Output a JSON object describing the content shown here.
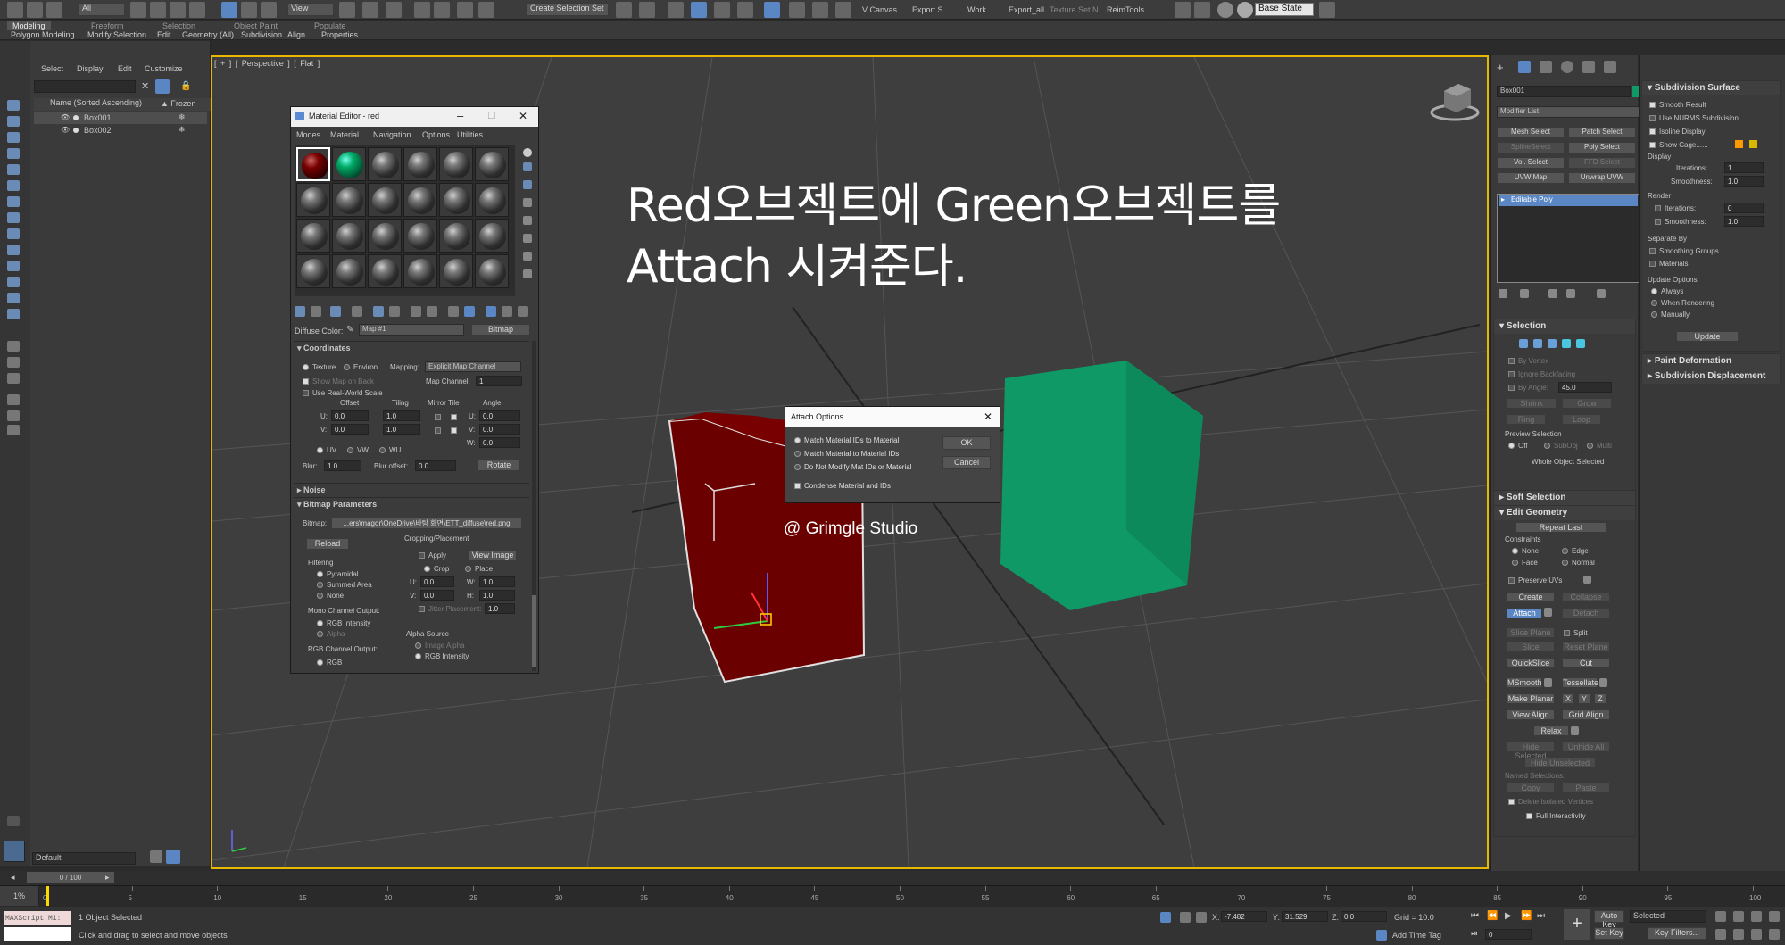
{
  "toolbar": {
    "filter": "All",
    "view": "View",
    "selection_set": "Create Selection Set",
    "base_state": "Base State",
    "items": [
      "V Canvas",
      "Export S",
      "Work",
      "Export_all",
      "Texture Set N",
      "ReimTools"
    ]
  },
  "ribbon_tabs": [
    "Modeling",
    "Freeform",
    "Selection",
    "Object Paint",
    "Populate"
  ],
  "ribbon_sub": [
    "Polygon Modeling",
    "Modify Selection",
    "Edit",
    "Geometry (All)",
    "Subdivision",
    "Align",
    "Properties"
  ],
  "scene_explorer": {
    "menu": [
      "Select",
      "Display",
      "Edit",
      "Customize"
    ],
    "column": "Name (Sorted Ascending)",
    "frozen": "▲ Frozen",
    "items": [
      "Box001",
      "Box002"
    ]
  },
  "viewport": {
    "label": "[ + ] [ Perspective ] [ Flat ]",
    "title_line1": "Red오브젝트에 Green오브젝트를",
    "title_line2": "Attach 시켜준다.",
    "watermark": "@ Grimgle Studio"
  },
  "material_editor": {
    "title": "Material Editor - red",
    "menu": [
      "Modes",
      "Material",
      "Navigation",
      "Options",
      "Utilities"
    ],
    "diffuse_label": "Diffuse Color:",
    "map_name": "Map #1",
    "map_type": "Bitmap",
    "coordinates": {
      "title": "Coordinates",
      "texture": "Texture",
      "environ": "Environ",
      "mapping_label": "Mapping:",
      "mapping_value": "Explicit Map Channel",
      "show_map": "Show Map on Back",
      "map_channel_label": "Map Channel:",
      "map_channel": "1",
      "real_world": "Use Real-World Scale",
      "offset": "Offset",
      "tiling": "Tiling",
      "mirror_tile": "Mirror Tile",
      "angle": "Angle",
      "u": "U:",
      "v": "V:",
      "w": "W:",
      "u_offset": "0.0",
      "v_offset": "0.0",
      "u_tiling": "1.0",
      "v_tiling": "1.0",
      "u_angle": "0.0",
      "v_angle": "0.0",
      "w_angle": "0.0",
      "uv": "UV",
      "vw": "VW",
      "wu": "WU",
      "blur_label": "Blur:",
      "blur": "1.0",
      "blur_offset_label": "Blur offset:",
      "blur_offset": "0.0",
      "rotate": "Rotate"
    },
    "noise": "Noise",
    "bitmap_params": {
      "title": "Bitmap Parameters",
      "bitmap_label": "Bitmap:",
      "path": "...ers\\magor\\OneDrive\\바탕 화면\\ETT_diffuse\\red.png",
      "reload": "Reload",
      "cropping": "Cropping/Placement",
      "apply": "Apply",
      "view_image": "View Image",
      "crop": "Crop",
      "place": "Place",
      "filtering": "Filtering",
      "pyramidal": "Pyramidal",
      "summed": "Summed Area",
      "none": "None",
      "u": "U:",
      "v": "V:",
      "w": "W:",
      "h": "H:",
      "u_val": "0.0",
      "v_val": "0.0",
      "w_val": "1.0",
      "h_val": "1.0",
      "jitter": "Jitter Placement:",
      "jitter_val": "1.0",
      "mono": "Mono Channel Output:",
      "rgb_intensity": "RGB Intensity",
      "alpha": "Alpha",
      "rgb_out": "RGB Channel Output:",
      "rgb": "RGB",
      "alpha_source": "Alpha Source",
      "image_alpha": "Image Alpha",
      "rgb_intensity2": "RGB Intensity"
    }
  },
  "attach_dialog": {
    "title": "Attach Options",
    "options": [
      "Match Material IDs to Material",
      "Match Material to Material IDs",
      "Do Not Modify Mat IDs or Material"
    ],
    "condense": "Condense Material and IDs",
    "ok": "OK",
    "cancel": "Cancel"
  },
  "command_panel": {
    "object_name": "Box001",
    "modifier_list": "Modifier List",
    "buttons": [
      "Mesh Select",
      "Patch Select",
      "SplineSelect",
      "Poly Select",
      "Vol. Select",
      "FFD Select",
      "UVW Map",
      "Unwrap UVW"
    ],
    "stack_item": "Editable Poly",
    "selection": {
      "title": "Selection",
      "by_vertex": "By Vertex",
      "ignore_backfacing": "Ignore Backfacing",
      "by_angle": "By Angle:",
      "angle": "45.0",
      "shrink": "Shrink",
      "grow": "Grow",
      "ring": "Ring",
      "loop": "Loop",
      "preview": "Preview Selection",
      "off": "Off",
      "subobj": "SubObj",
      "multi": "Multi",
      "whole": "Whole Object Selected"
    },
    "soft_selection": "Soft Selection",
    "edit_geometry": {
      "title": "Edit Geometry",
      "repeat_last": "Repeat Last",
      "constraints": "Constraints",
      "none": "None",
      "edge": "Edge",
      "face": "Face",
      "normal": "Normal",
      "preserve_uvs": "Preserve UVs",
      "create": "Create",
      "collapse": "Collapse",
      "attach": "Attach",
      "detach": "Detach",
      "slice_plane": "Slice Plane",
      "split": "Split",
      "slice": "Slice",
      "reset_plane": "Reset Plane",
      "quickslice": "QuickSlice",
      "cut": "Cut",
      "msmooth": "MSmooth",
      "tessellate": "Tessellate",
      "make_planar": "Make Planar",
      "x": "X",
      "y": "Y",
      "z": "Z",
      "view_align": "View Align",
      "grid_align": "Grid Align",
      "relax": "Relax",
      "hide_selected": "Hide Selected",
      "unhide_all": "Unhide All",
      "hide_unselected": "Hide Unselected",
      "named_selections": "Named Selections:",
      "copy": "Copy",
      "paste": "Paste",
      "delete_isolated": "Delete Isolated Vertices",
      "full_interactivity": "Full Interactivity"
    }
  },
  "subdivision_panel": {
    "title": "Subdivision Surface",
    "smooth_result": "Smooth Result",
    "use_nurms": "Use NURMS Subdivision",
    "isoline": "Isoline Display",
    "show_cage": "Show Cage......",
    "display": "Display",
    "iterations_label": "Iterations:",
    "iterations": "1",
    "smoothness_label": "Smoothness:",
    "smoothness": "1.0",
    "render": "Render",
    "r_iterations": "0",
    "r_smoothness": "1.0",
    "separate_by": "Separate By",
    "smoothing_groups": "Smoothing Groups",
    "materials": "Materials",
    "update_options": "Update Options",
    "always": "Always",
    "when_rendering": "When Rendering",
    "manually": "Manually",
    "update": "Update",
    "paint_deformation": "Paint Deformation",
    "subdivision_displacement": "Subdivision Displacement"
  },
  "timeline": {
    "frame": "0 / 100",
    "layer": "Default",
    "ticks": [
      "0",
      "5",
      "10",
      "15",
      "20",
      "25",
      "30",
      "35",
      "40",
      "45",
      "50",
      "55",
      "60",
      "65",
      "70",
      "75",
      "80",
      "85",
      "90",
      "95",
      "100"
    ]
  },
  "status": {
    "objects_selected": "1 Object Selected",
    "prompt": "Click and drag to select and move objects",
    "maxscript": "MAXScript Mi:",
    "x_label": "X:",
    "x": "-7.482",
    "y_label": "Y:",
    "y": "31.529",
    "z_label": "Z:",
    "z": "0.0",
    "grid": "Grid = 10.0",
    "add_time_tag": "Add Time Tag",
    "auto_key": "Auto Key",
    "selected": "Selected",
    "set_key": "Set Key",
    "key_filters": "Key Filters...",
    "current_frame": "0",
    "zoom": "1%"
  },
  "colors": {
    "red_box": "#6b0000",
    "green_box": "#0f9966",
    "accent": "#5b86c4"
  }
}
